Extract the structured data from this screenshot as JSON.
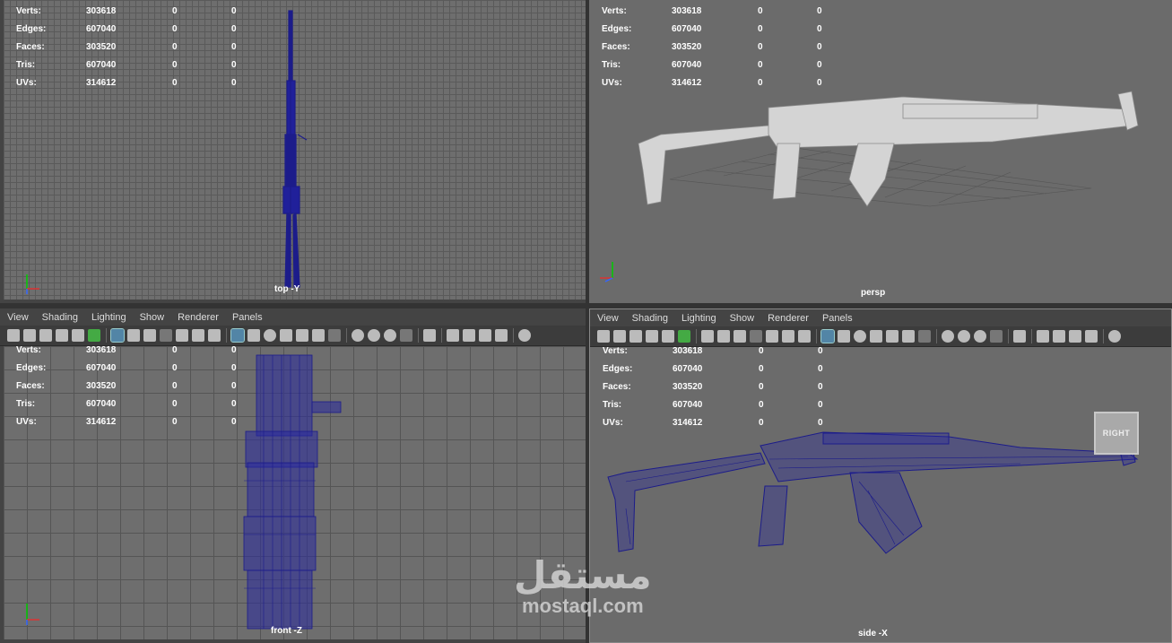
{
  "menus": [
    "View",
    "Shading",
    "Lighting",
    "Show",
    "Renderer",
    "Panels"
  ],
  "hud": {
    "rows": [
      {
        "label": "Verts:",
        "v1": "303618",
        "v2": "0",
        "v3": "0"
      },
      {
        "label": "Edges:",
        "v1": "607040",
        "v2": "0",
        "v3": "0"
      },
      {
        "label": "Faces:",
        "v1": "303520",
        "v2": "0",
        "v3": "0"
      },
      {
        "label": "Tris:",
        "v1": "607040",
        "v2": "0",
        "v3": "0"
      },
      {
        "label": "UVs:",
        "v1": "314612",
        "v2": "0",
        "v3": "0"
      }
    ]
  },
  "viewports": {
    "top": {
      "camera": "top -Y"
    },
    "persp": {
      "camera": "persp"
    },
    "front": {
      "camera": "front -Z"
    },
    "side": {
      "camera": "side -X",
      "viewcube": "RIGHT"
    }
  },
  "watermark": {
    "arabic": "مستقل",
    "latin": "mostaql.com"
  },
  "colors": {
    "wire": "#1c1c8a",
    "highlight": "#5285a6",
    "panel": "#444444"
  }
}
